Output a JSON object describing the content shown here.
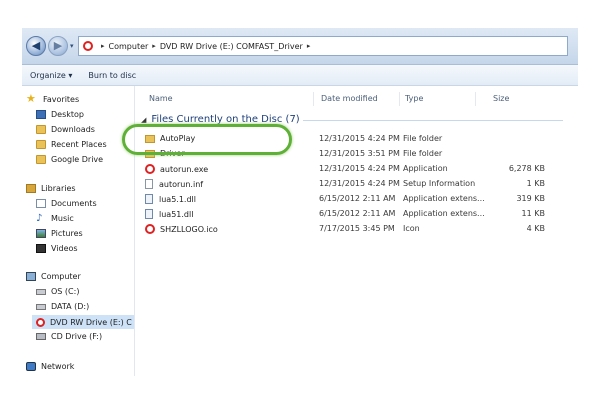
{
  "address_bar": {
    "back_label": "◀",
    "forward_label": "▶",
    "recent_label": "▾",
    "path": [
      "Computer",
      "DVD RW Drive (E:) COMFAST_Driver"
    ],
    "separator": "▸"
  },
  "toolbar": {
    "organize_label": "Organize ▾",
    "burn_label": "Burn to disc"
  },
  "nav_pane": {
    "favorites_label": "Favorites",
    "favorites": [
      "Desktop",
      "Downloads",
      "Recent Places",
      "Google Drive"
    ],
    "libraries_label": "Libraries",
    "libraries": [
      "Documents",
      "Music",
      "Pictures",
      "Videos"
    ],
    "computer_label": "Computer",
    "drives": [
      "OS (C:)",
      "DATA (D:)",
      "DVD RW Drive (E:) C",
      "CD Drive (F:)"
    ],
    "network_label": "Network"
  },
  "columns": {
    "name": "Name",
    "date": "Date modified",
    "type": "Type",
    "size": "Size"
  },
  "group": {
    "label": "Files Currently on the Disc (7)"
  },
  "files": [
    {
      "name": "AutoPlay",
      "date": "12/31/2015 4:24 PM",
      "type": "File folder",
      "size": "",
      "icon": "folder-icon"
    },
    {
      "name": "Driver",
      "date": "12/31/2015 3:51 PM",
      "type": "File folder",
      "size": "",
      "icon": "folder-icon"
    },
    {
      "name": "autorun.exe",
      "date": "12/31/2015 4:24 PM",
      "type": "Application",
      "size": "6,278 KB",
      "icon": "application-icon"
    },
    {
      "name": "autorun.inf",
      "date": "12/31/2015 4:24 PM",
      "type": "Setup Information",
      "size": "1 KB",
      "icon": "setup-file-icon"
    },
    {
      "name": "lua5.1.dll",
      "date": "6/15/2012 2:11 AM",
      "type": "Application extens...",
      "size": "319 KB",
      "icon": "dll-icon"
    },
    {
      "name": "lua51.dll",
      "date": "6/15/2012 2:11 AM",
      "type": "Application extens...",
      "size": "11 KB",
      "icon": "dll-icon"
    },
    {
      "name": "SHZLLOGO.ico",
      "date": "7/17/2015 3:45 PM",
      "type": "Icon",
      "size": "4 KB",
      "icon": "ico-file-icon"
    }
  ],
  "colors": {
    "highlight": "#5fb037",
    "selected_nav": "#cde2f7",
    "group_text": "#1e3f7a"
  }
}
